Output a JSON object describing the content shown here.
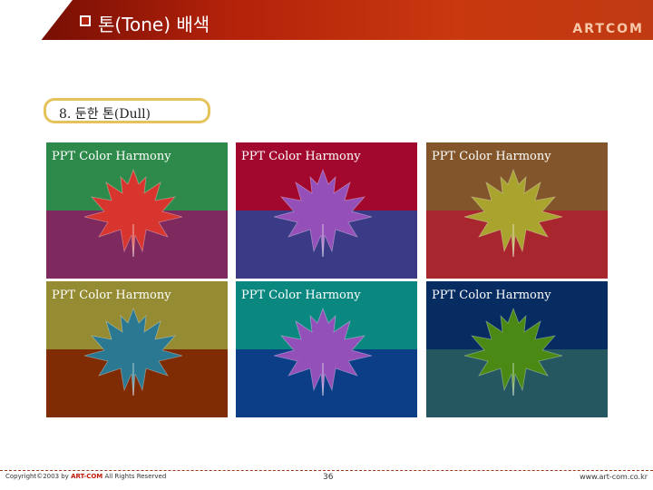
{
  "header": {
    "title": "톤(Tone) 배색",
    "brand": "ARTCOM"
  },
  "section_label": "8. 둔한 톤(Dull)",
  "swatches": [
    {
      "label": "PPT Color Harmony",
      "top_color": "#2e8a4a",
      "bottom_color": "#7f2a5e",
      "leaf_color": "#d8352e"
    },
    {
      "label": "PPT Color Harmony",
      "top_color": "#a2072e",
      "bottom_color": "#3a3a86",
      "leaf_color": "#9450b8"
    },
    {
      "label": "PPT Color Harmony",
      "top_color": "#82562a",
      "bottom_color": "#a8272e",
      "leaf_color": "#a8a42e"
    },
    {
      "label": "PPT Color Harmony",
      "top_color": "#958b32",
      "bottom_color": "#7f2c05",
      "leaf_color": "#2a7891"
    },
    {
      "label": "PPT Color Harmony",
      "top_color": "#0a8880",
      "bottom_color": "#0b3e86",
      "leaf_color": "#9250b8"
    },
    {
      "label": "PPT Color Harmony",
      "top_color": "#072c62",
      "bottom_color": "#255760",
      "leaf_color": "#4a8a14"
    }
  ],
  "footer": {
    "copyright_prefix": "Copyright©2003 by ",
    "copyright_brand": "ART-COM",
    "copyright_suffix": " All Rights Reserved",
    "page_number": "36",
    "website": "www.art-com.co.kr"
  }
}
